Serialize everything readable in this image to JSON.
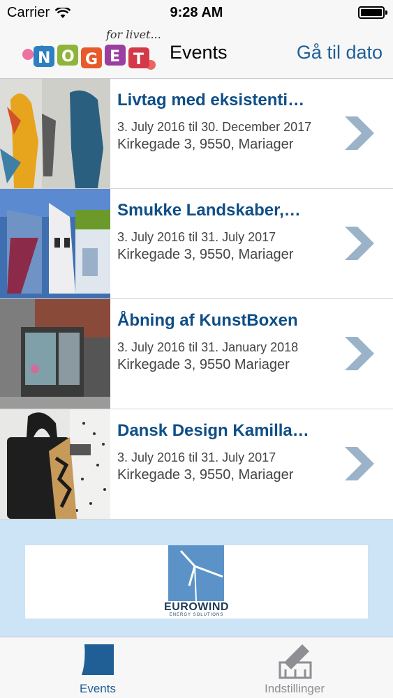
{
  "status_bar": {
    "carrier": "Carrier",
    "time": "9:28 AM"
  },
  "nav": {
    "title": "Events",
    "right_button": "Gå til dato",
    "logo_tagline": "for livet...",
    "logo_letters": [
      "N",
      "O",
      "G",
      "E",
      "T"
    ]
  },
  "events": [
    {
      "title": "Livtag med eksistenti…",
      "date": "3. July 2016 til 30. December 2017",
      "address": "Kirkegade 3, 9550, Mariager"
    },
    {
      "title": "Smukke Landskaber,…",
      "date": "3. July 2016 til 31. July 2017",
      "address": "Kirkegade 3, 9550, Mariager"
    },
    {
      "title": "Åbning af KunstBoxen",
      "date": "3. July 2016 til 31. January 2018",
      "address": "Kirkegade 3, 9550 Mariager"
    },
    {
      "title": "Dansk Design Kamilla…",
      "date": "3. July 2016 til 31. July 2017",
      "address": "Kirkegade 3, 9550, Mariager"
    }
  ],
  "ad": {
    "brand": "EUROWIND",
    "tagline": "ENERGY SOLUTIONS"
  },
  "tabs": [
    {
      "label": "Events",
      "icon": "events-icon",
      "active": true
    },
    {
      "label": "Indstillinger",
      "icon": "settings-icon",
      "active": false
    }
  ],
  "colors": {
    "accent": "#1f5f96",
    "title": "#0f4e86",
    "ad_background": "#cde3f6",
    "chevron": "#9bb3c8"
  }
}
